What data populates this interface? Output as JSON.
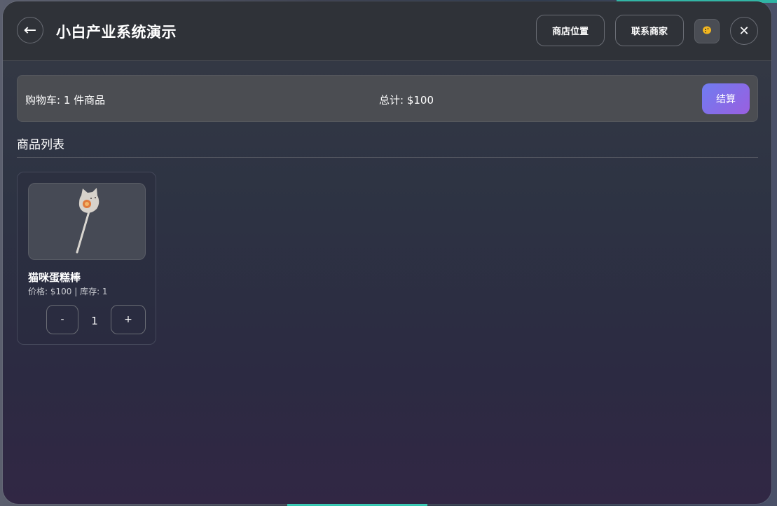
{
  "window": {
    "title": "小白产业系统演示"
  },
  "header": {
    "back_icon": "←",
    "location_button": "商店位置",
    "contact_button": "联系商家",
    "theme_icon": "🍋",
    "close_icon": "✕"
  },
  "cart": {
    "count_text": "购物车: 1 件商品",
    "total_text": "总计: $100",
    "checkout_label": "结算"
  },
  "products_section": {
    "title": "商品列表",
    "items": [
      {
        "name": "猫咪蛋糕棒",
        "meta": "价格: $100 | 库存: 1",
        "image_icon": "cat-cake-pop-image",
        "quantity": "1",
        "minus_label": "-",
        "plus_label": "+"
      }
    ]
  },
  "colors": {
    "checkout_gradient_start": "#6f7cf0",
    "checkout_gradient_end": "#9a5fe0",
    "header_bg": "#2f3238",
    "cart_bar_bg": "#4b4d52"
  }
}
